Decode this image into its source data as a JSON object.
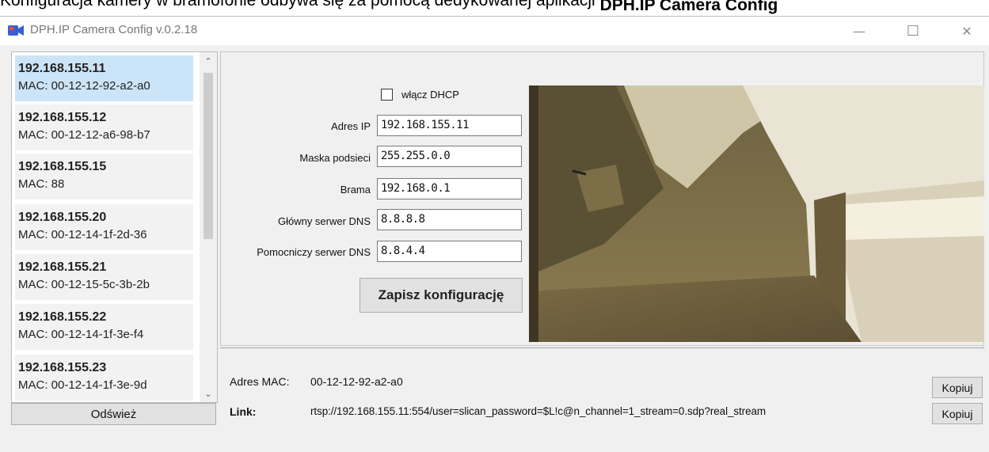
{
  "document": {
    "text_before": "Konfiguracja kamery w bramofonie odbywa się za pomocą dedykowanej aplikacji ",
    "text_bold": "DPH.IP Camera Config"
  },
  "window": {
    "title": "DPH.IP Camera Config v.0.2.18",
    "minimize": "—",
    "maximize": "☐",
    "close": "✕"
  },
  "device_list": {
    "items": [
      {
        "ip": "192.168.155.11",
        "mac": "MAC: 00-12-12-92-a2-a0",
        "selected": true
      },
      {
        "ip": "192.168.155.12",
        "mac": "MAC: 00-12-12-a6-98-b7"
      },
      {
        "ip": "192.168.155.15",
        "mac": "MAC: 88"
      },
      {
        "ip": "192.168.155.20",
        "mac": "MAC: 00-12-14-1f-2d-36"
      },
      {
        "ip": "192.168.155.21",
        "mac": "MAC: 00-12-15-5c-3b-2b"
      },
      {
        "ip": "192.168.155.22",
        "mac": "MAC: 00-12-14-1f-3e-f4"
      },
      {
        "ip": "192.168.155.23",
        "mac": "MAC: 00-12-14-1f-3e-9d"
      }
    ],
    "refresh_label": "Odśwież"
  },
  "config": {
    "dhcp_label": "włącz DHCP",
    "dhcp_checked": false,
    "ip_label": "Adres IP",
    "ip_value": "192.168.155.11",
    "mask_label": "Maska podsieci",
    "mask_value": "255.255.0.0",
    "gateway_label": "Brama",
    "gateway_value": "192.168.0.1",
    "dns1_label": "Główny serwer  DNS",
    "dns1_value": "8.8.8.8",
    "dns2_label": "Pomocniczy serwer DNS",
    "dns2_value": "8.8.4.4",
    "save_label": "Zapisz konfigurację"
  },
  "info": {
    "mac_label": "Adres MAC:",
    "mac_value": "00-12-12-92-a2-a0",
    "link_label": "Link:",
    "link_value": "rtsp://192.168.155.11:554/user=slican_password=$L!c@n_channel=1_stream=0.sdp?real_stream",
    "copy_label": "Kopiuj"
  }
}
